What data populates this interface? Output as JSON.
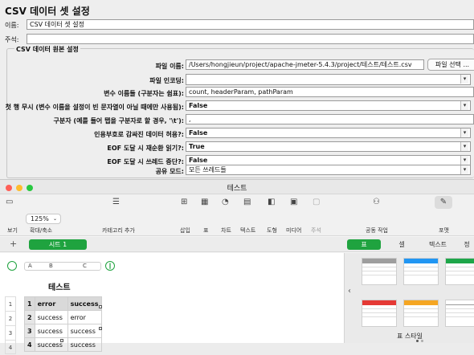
{
  "jmeter": {
    "heading": "CSV 데이터 셋 설정",
    "name_label": "이름:",
    "name_value": "CSV 데이터 셋 설정",
    "comment_label": "주석:",
    "comment_value": "",
    "section_title": "CSV 데이터 원본 설정",
    "filename_label": "파일 이름:",
    "filename_value": "/Users/hongjieun/project/apache-jmeter-5.4.3/project/테스트/테스트.csv",
    "browse_button": "파일 선택 ...",
    "encoding_label": "파일 인코딩:",
    "encoding_value": "",
    "varnames_label": "변수 이름들 (구분자는 쉼표):",
    "varnames_value": "count, headerParam, pathParam",
    "ignore_header_label": "첫 행 무시 (변수 이름을 설정이 빈 문자열이 아닐 때에만 사용됨):",
    "ignore_header_value": "False",
    "delimiter_label": "구분자 (예를 들어 탭을 구분자로 할 경우, '\\t'):",
    "delimiter_value": ",",
    "quoted_label": "인용부호로 감싸진 데이터 허용?:",
    "quoted_value": "False",
    "recycle_label": "EOF 도달 시 재순환 읽기?:",
    "recycle_value": "True",
    "stop_label": "EOF 도달 시 쓰레드 중단?:",
    "stop_value": "False",
    "sharing_label": "공유 모드:",
    "sharing_value": "모든 쓰레드들"
  },
  "numbers": {
    "window_title": "테스트",
    "toolbar": {
      "view": "보기",
      "zoom_value": "125%",
      "zoom_label": "확대/축소",
      "add_category": "카테고리 추가",
      "insert": "삽입",
      "table": "표",
      "chart": "차트",
      "text": "텍스트",
      "shape": "도형",
      "media": "미디어",
      "comment": "주석",
      "collaborate": "공동 작업",
      "format": "포맷"
    },
    "sheet_tab": "시트 1",
    "add_sheet": "+",
    "format_tabs": [
      "표",
      "셀",
      "텍스트",
      "정"
    ],
    "column_headers": [
      "A",
      "B",
      "C"
    ],
    "table_title": "테스트",
    "row_numbers": [
      "1",
      "2",
      "3",
      "4"
    ],
    "rows": [
      [
        "1",
        "error",
        "success"
      ],
      [
        "2",
        "success",
        "error"
      ],
      [
        "3",
        "success",
        "success"
      ],
      [
        "4",
        "success",
        "success"
      ]
    ],
    "panel_caption": "표 스타일",
    "colors": {
      "accent_green": "#1fa33f",
      "style_blue": "#2196f3",
      "style_green": "#1ea64a",
      "style_red": "#e53935",
      "style_orange": "#f5a623"
    }
  }
}
